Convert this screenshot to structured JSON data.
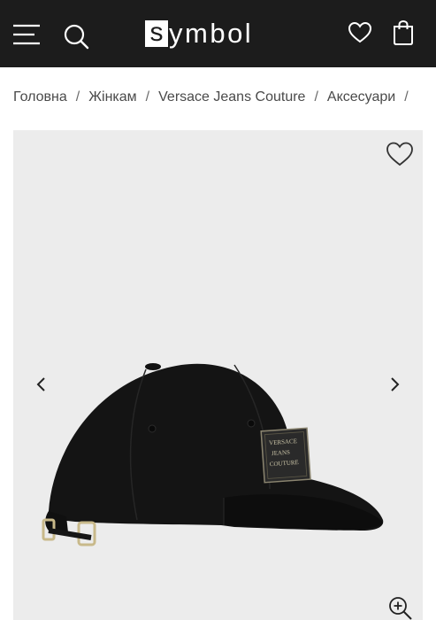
{
  "header": {
    "logo_letter": "s",
    "logo_rest": "ymbol",
    "icons": [
      "menu-icon",
      "search-icon",
      "heart-icon",
      "shopping-bag-icon"
    ],
    "background": "#1c1c1c"
  },
  "breadcrumb": {
    "items": [
      "Головна",
      "Жінкам",
      "Versace Jeans Couture",
      "Аксесуари"
    ],
    "separator": "/"
  },
  "gallery": {
    "background": "#ececec",
    "icons": [
      "favorite-heart-icon",
      "chevron-left-icon",
      "chevron-right-icon",
      "zoom-in-icon"
    ],
    "patch_text": [
      "VERSACE",
      "JEANS",
      "COUTURE"
    ]
  }
}
